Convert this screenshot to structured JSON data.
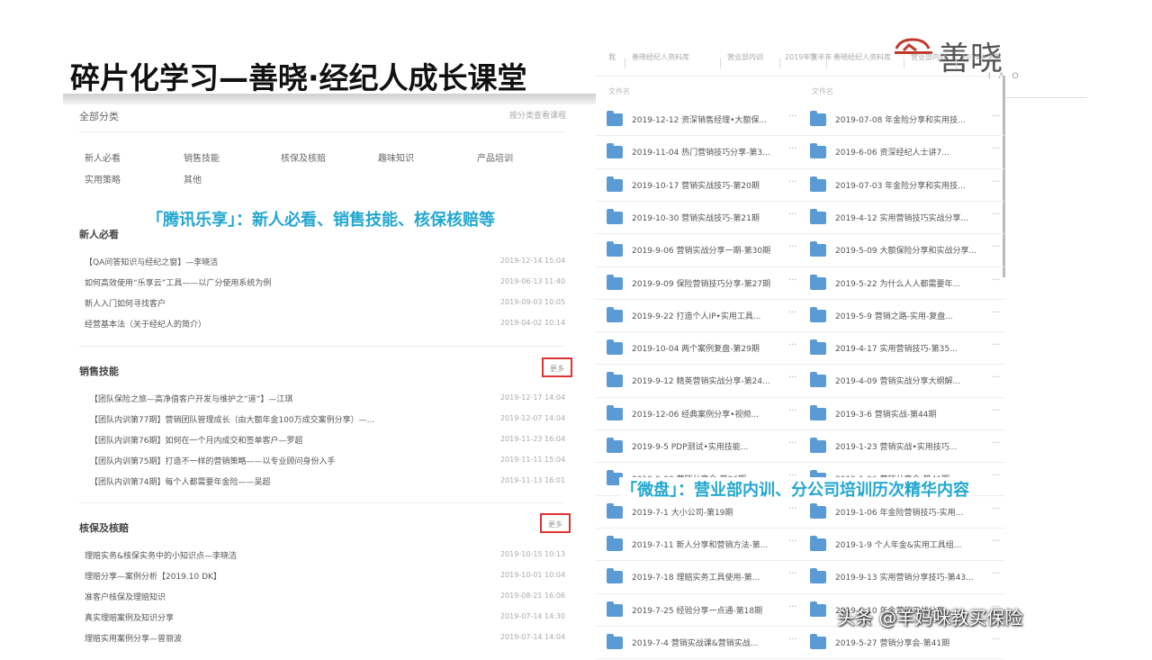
{
  "title": "碎片化学习—善晓·经纪人成长课堂",
  "logo": {
    "text": "善晓",
    "sub": "I A O"
  },
  "left": {
    "all_categories": "全部分类",
    "cat_link": "按分类查看课程",
    "categories": [
      "新人必看",
      "销售技能",
      "核保及核赔",
      "趣味知识",
      "产品培训",
      "实用策略",
      "其他"
    ],
    "annotation": "「腾讯乐享」：新人必看、销售技能、核保核赔等",
    "sections": [
      {
        "title": "新人必看",
        "more": "",
        "rows": [
          {
            "text": "【QA问答知识与经纪之窗】—李晓洁",
            "date": "2019-12-14 15:04"
          },
          {
            "text": "如何高效使用“乐享云”工具——以广分使用系统为例",
            "date": "2019-06-13 11:40"
          },
          {
            "text": "新人入门如何寻找客户",
            "date": "2019-09-03 10:05"
          },
          {
            "text": "经营基本法（关于经纪人的简介）",
            "date": "2019-04-02 10:14"
          }
        ]
      },
      {
        "title": "销售技能",
        "more": "更多",
        "rows": [
          {
            "text": "【团队保险之旅—高净值客户开发与维护之“道”】—江琪",
            "date": "2019-12-17 14:04"
          },
          {
            "text": "【团队内训第77期】营销团队管理成长（由大额年金100万成交案例分享）—...",
            "date": "2019-12-07 14:04"
          },
          {
            "text": "【团队内训第76期】如何在一个月内成交和签单客户—罗超",
            "date": "2019-11-23 16:04"
          },
          {
            "text": "【团队内训第75期】打造不一样的营销策略——以专业顾问身份入手",
            "date": "2019-11-11 15:04"
          },
          {
            "text": "【团队内训第74期】每个人都需要年金险——吴超",
            "date": "2019-11-13 16:01"
          }
        ]
      },
      {
        "title": "核保及核赔",
        "more": "更多",
        "rows": [
          {
            "text": "理赔实务&核保实务中的小知识点—李晓洁",
            "date": "2019-10-15 10:13"
          },
          {
            "text": "理赔分享—案例分析【2019.10 DK】",
            "date": "2019-10-01 10:04"
          },
          {
            "text": "准客户核保及理赔知识",
            "date": "2019-08-21 16:06"
          },
          {
            "text": "真实理赔案例及知识分享",
            "date": "2019-07-14 14:30"
          },
          {
            "text": "理赔实用案例分享—曾丽波",
            "date": "2019-07-14 14:04"
          }
        ]
      }
    ]
  },
  "right": {
    "breadcrumbs": [
      "我",
      "善晓经纪人资料库",
      "营业部内训",
      "2019年下半年",
      "我",
      "善晓经纪人资料库",
      "营业部内训",
      "2019上半年"
    ],
    "col_headers": [
      "文件名",
      "文件名"
    ],
    "folders_left": [
      "2019-12-12 资深销售经理•大额保...",
      "2019-11-04 热门营销技巧分享-第3...",
      "2019-10-17 营销实战技巧-第20期",
      "2019-10-30 营销实战技巧-第21期",
      "2019-9-06 营销实战分享一期-第30期",
      "2019-9-09 保险营销技巧分享-第27期",
      "2019-9-22 打造个人IP•实用工具...",
      "2019-10-04 两个案例复盘-第29期",
      "2019-9-12 精英营销实战分享-第24...",
      "2019-12-06 经典案例分享•视频...",
      "2019-9-5 PDP测试•实用技能...",
      "2019-9-03 营销分享会-第26期",
      "2019-7-1 大小公司-第19期",
      "2019-7-11 新人分享和营销方法-第...",
      "2019-7-18 理赔实务工具使用-第...",
      "2019-7-25 经验分享一点通-第18期",
      "2019-7-4 营销实战课&营销实战..."
    ],
    "folders_right": [
      "2019-07-08 年金险分享和实用技...",
      "2019-6-06 资深经纪人士讲7...",
      "2019-07-03 年金险分享和实用技...",
      "2019-4-12 实用营销技巧实战分享...",
      "2019-5-09 大额保险分享和实战分享...",
      "2019-5-22 为什么人人都需要年...",
      "2019-5-9 营销之路-实用-复盘...",
      "2019-4-17 实用营销技巧-第35...",
      "2019-4-09 营销实战分享大纲解...",
      "2019-3-6 营销实战-第44期",
      "2019-1-23 营销实战•实用技巧...",
      "2019-1-06 营销分享会-第41期",
      "2019-1-06 年金险营销技巧-实用...",
      "2019-1-9 个人年金&实用工具组...",
      "2019-9-13 实用营销分享技巧-第43...",
      "2019-6-10 年金营销实战分享...",
      "2019-5-27 营销分享会-第41期"
    ],
    "dots": "···",
    "annotation": "「微盘」：营业部内训、分公司培训历次精华内容"
  },
  "watermark": "头条 @羊妈咪教买保险",
  "colors": {
    "accent_blue": "#22a7d0",
    "folder": "#5b9bd5",
    "highlight_red": "#d33",
    "logo_red": "#c0392b"
  }
}
